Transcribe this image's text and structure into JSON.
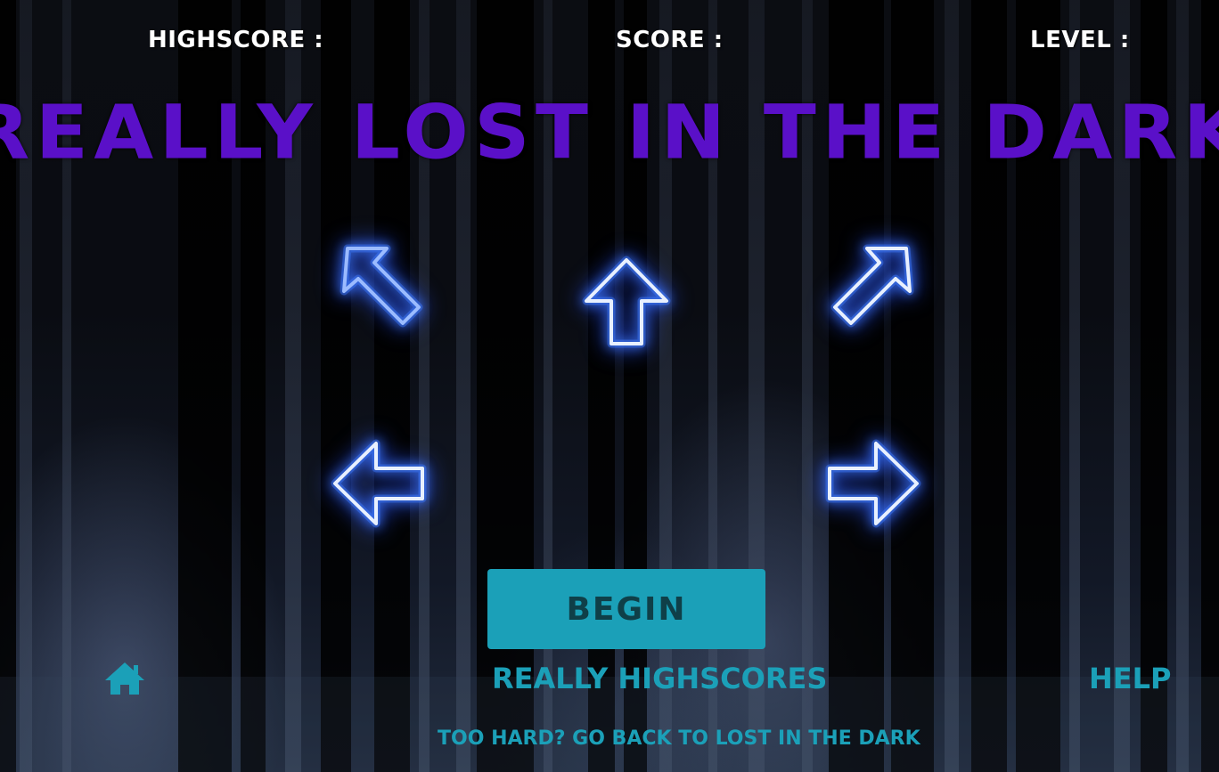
{
  "hud": {
    "highscore_label": "HIGHSCORE :",
    "score_label": "SCORE :",
    "level_label": "LEVEL :"
  },
  "title": "REALLY LOST IN THE DARK",
  "arrows": [
    {
      "name": "arrow-up-left",
      "icon": "arrow-up-left-icon"
    },
    {
      "name": "arrow-up",
      "icon": "arrow-up-icon"
    },
    {
      "name": "arrow-up-right",
      "icon": "arrow-up-right-icon"
    },
    {
      "name": "arrow-left",
      "icon": "arrow-left-icon"
    },
    {
      "name": "arrow-right",
      "icon": "arrow-right-icon"
    }
  ],
  "buttons": {
    "begin_label": "BEGIN"
  },
  "nav": {
    "home_icon": "home-icon",
    "highscores_label": "REALLY HIGHSCORES",
    "help_label": "HELP",
    "easier_mode_label": "TOO HARD? GO BACK TO LOST IN THE DARK"
  },
  "colors": {
    "title": "#5a10c8",
    "accent": "#1ba0b8",
    "arrow_glow": "#3f7bff",
    "hud_text": "#ffffff"
  }
}
